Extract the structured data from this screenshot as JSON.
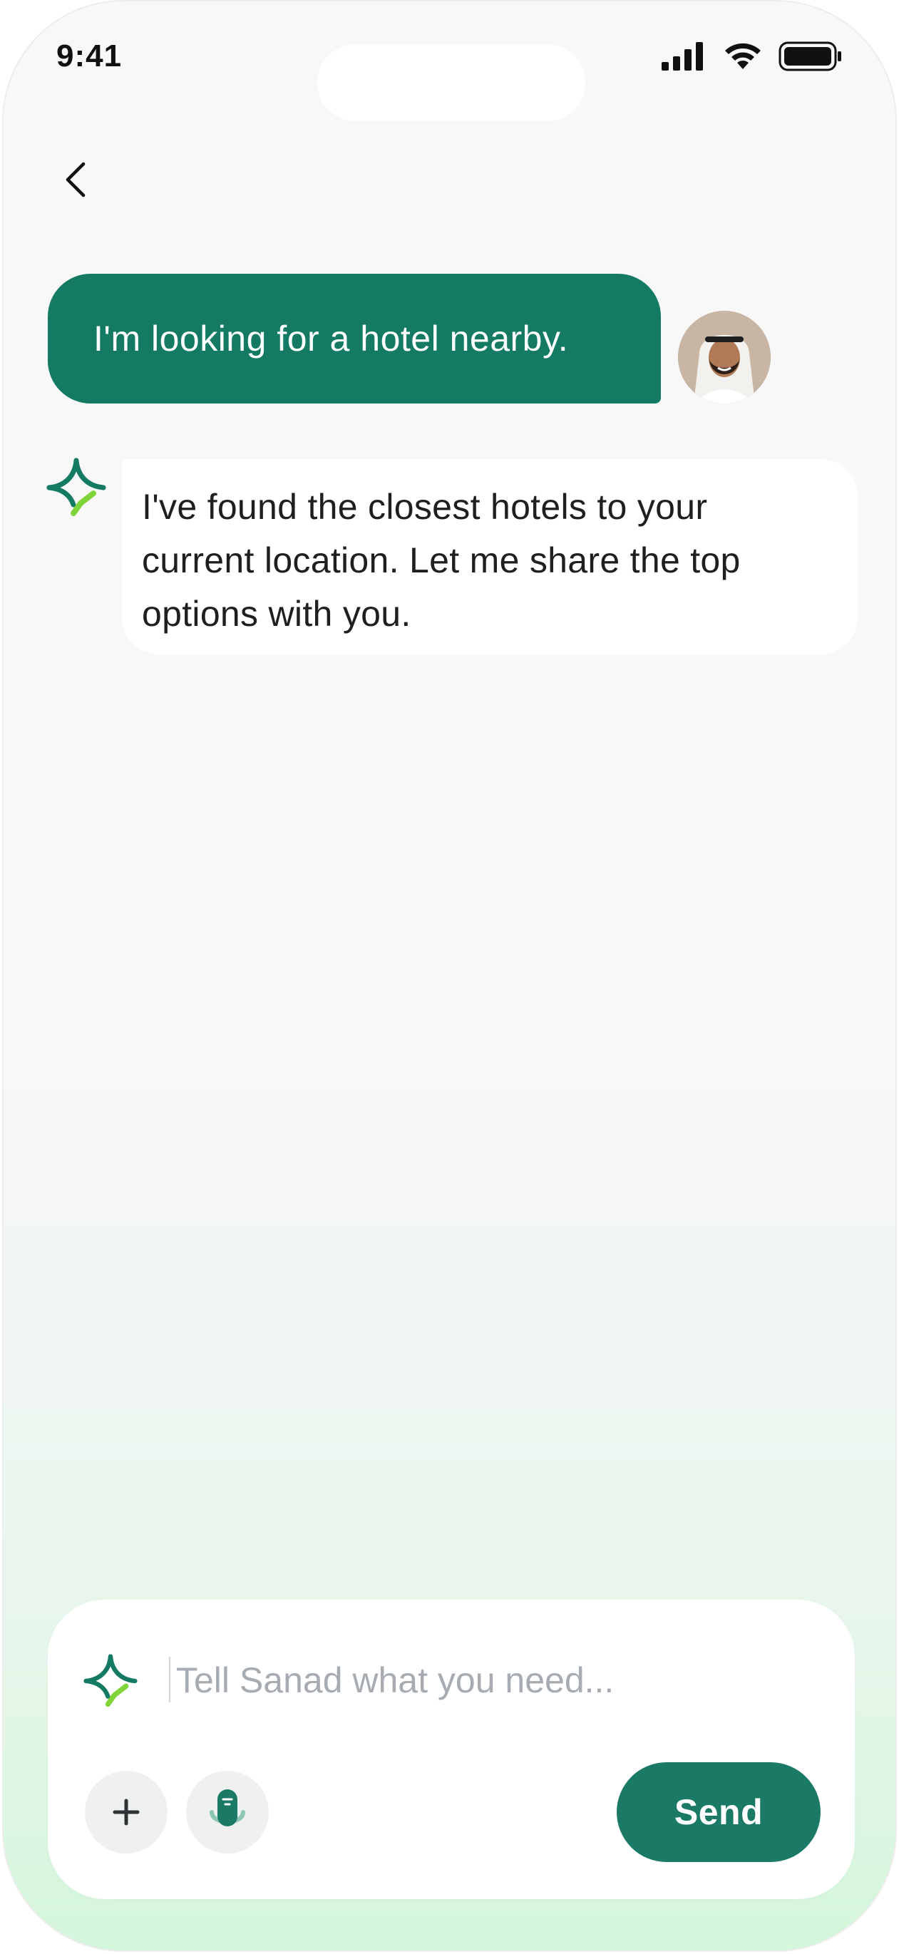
{
  "status_bar": {
    "time": "9:41",
    "icons": [
      "cellular-signal-icon",
      "wifi-icon",
      "battery-icon"
    ]
  },
  "header": {
    "back_icon": "chevron-left-icon"
  },
  "messages": [
    {
      "sender": "user",
      "text": "I'm looking for a hotel nearby."
    },
    {
      "sender": "assistant",
      "lines": [
        "I've found the closest hotels to your",
        "current location. Let me share the top",
        "options with you."
      ]
    }
  ],
  "composer": {
    "placeholder": "Tell Sanad what you need...",
    "value": "",
    "send_label": "Send",
    "add_icon": "plus-icon",
    "mic_icon": "microphone-icon"
  },
  "colors": {
    "brand_green": "#147a64",
    "accent_lime": "#7fd43a",
    "background": "#f8f8f8"
  }
}
